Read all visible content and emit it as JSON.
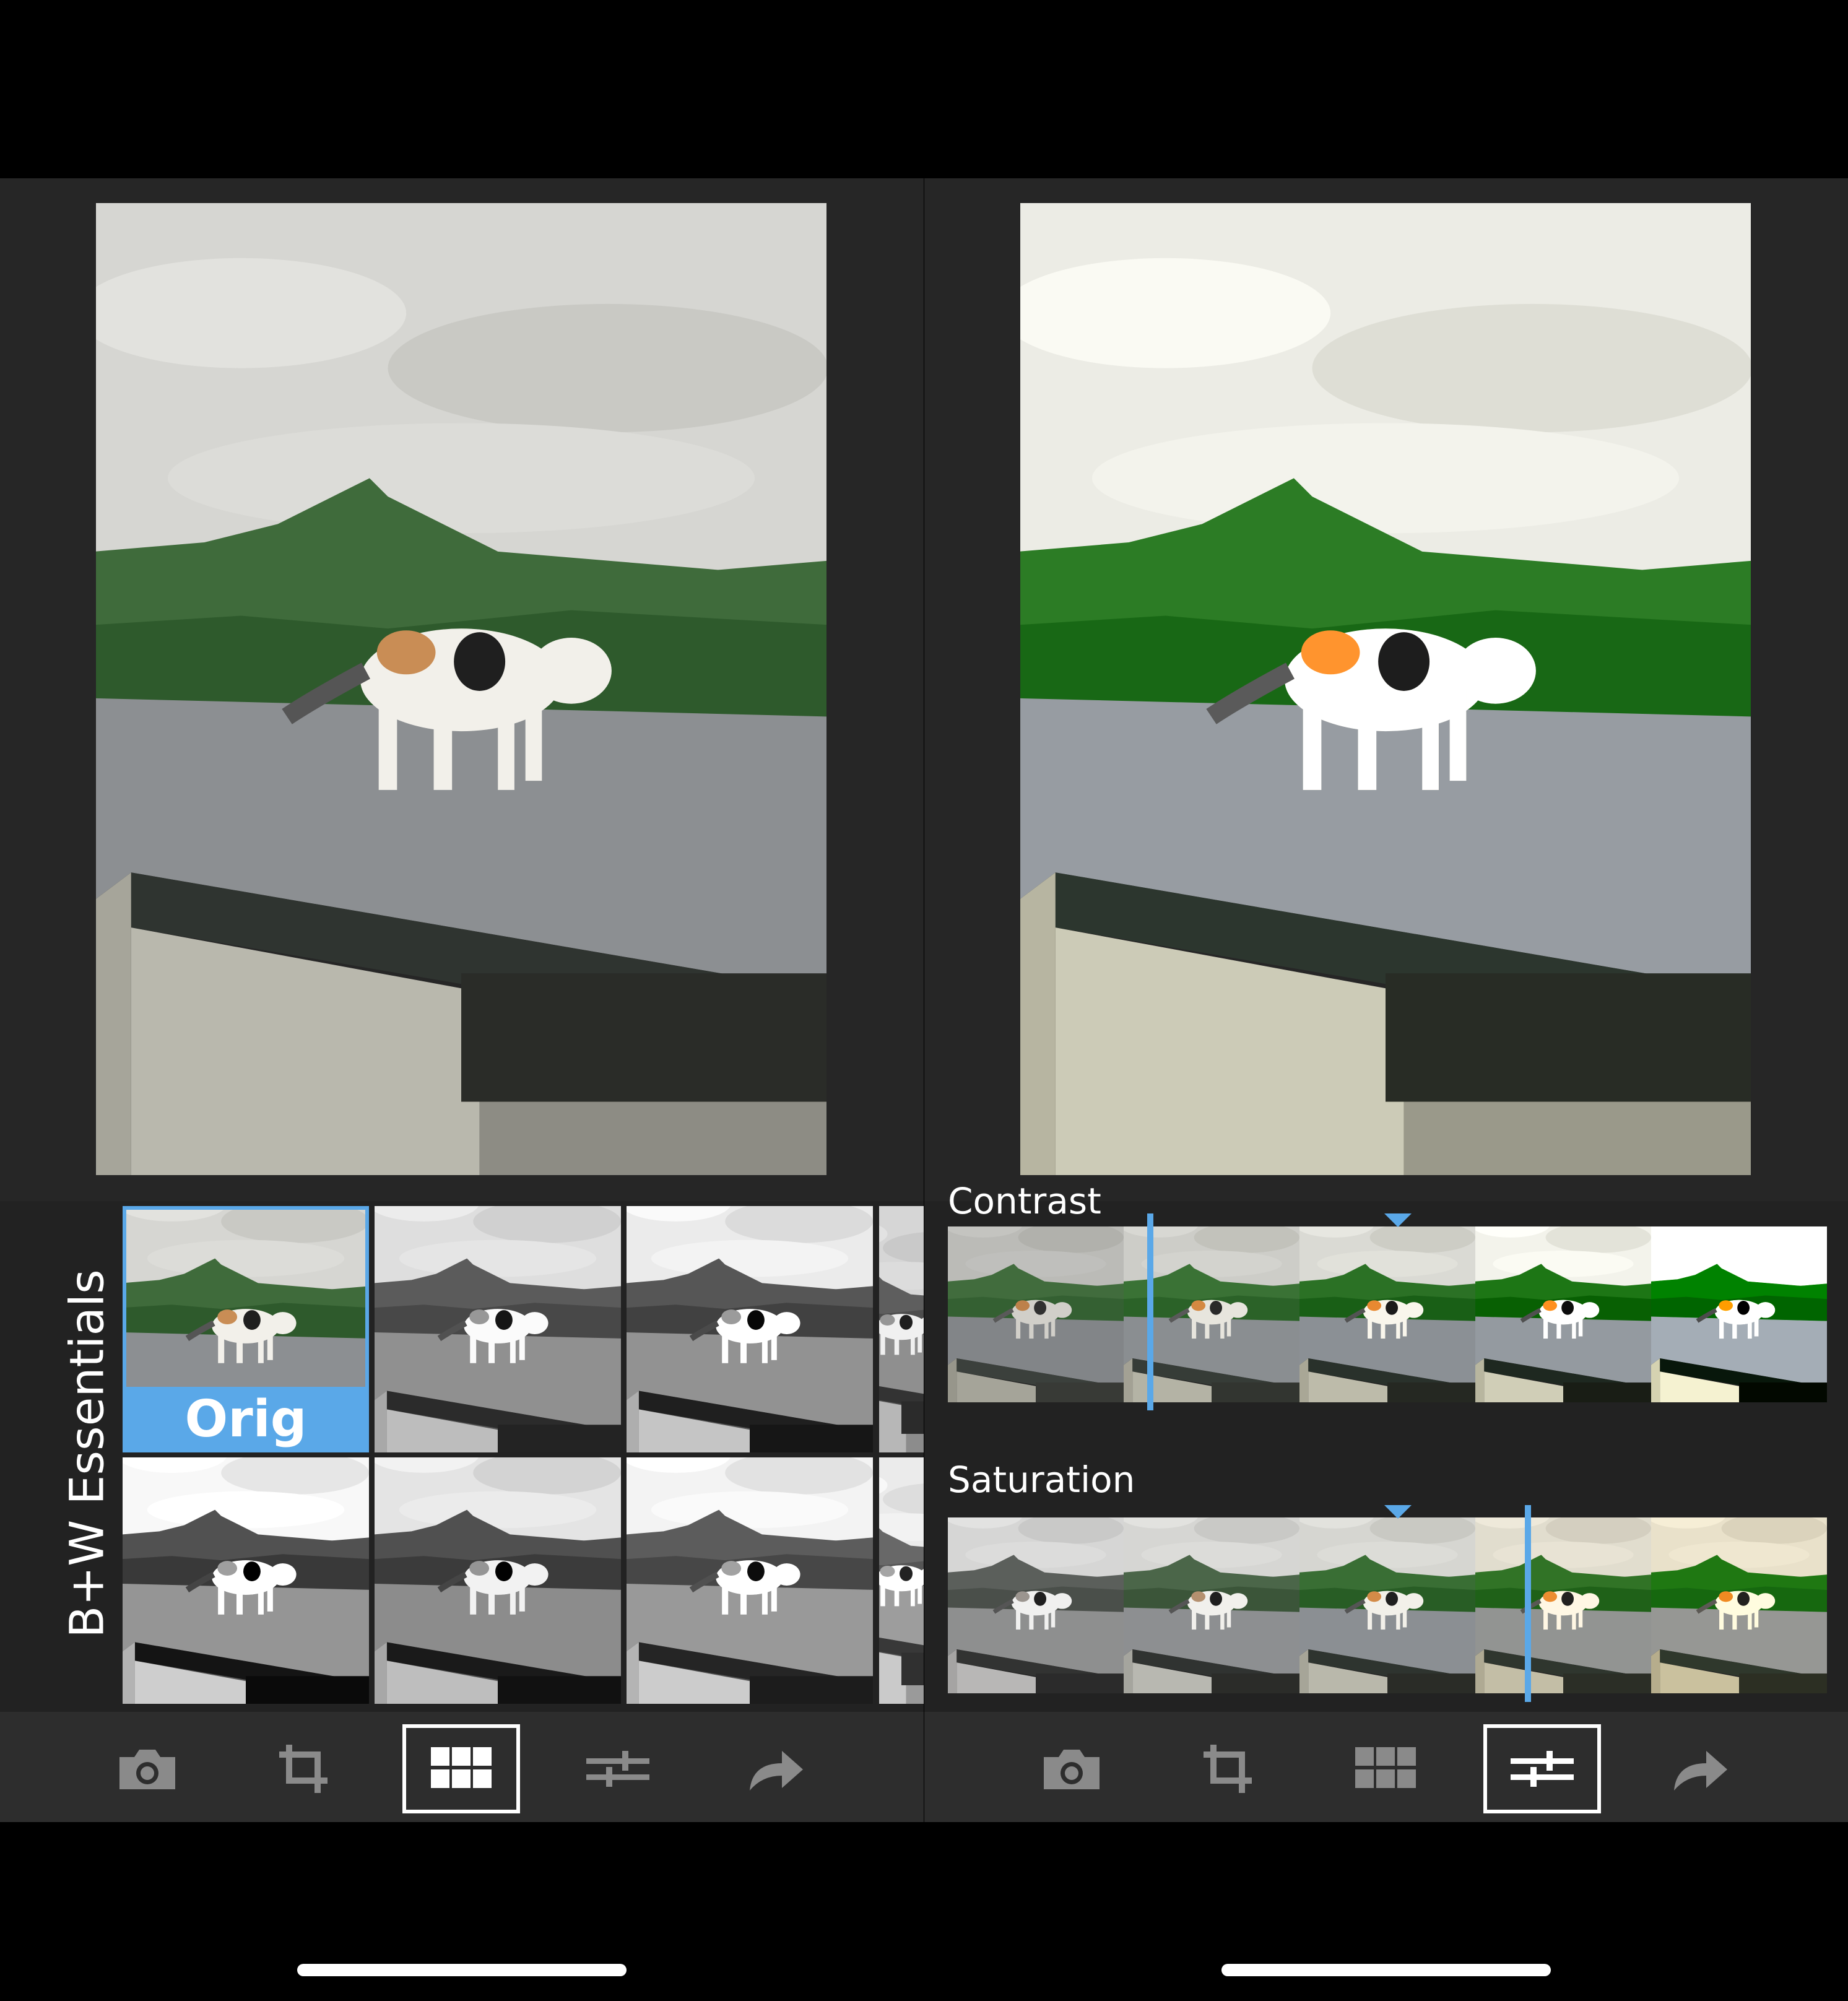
{
  "left_panel": {
    "section_title": "B+W Essentials",
    "selected_label": "Orig",
    "thumbnails": [
      {
        "filter": "orig",
        "selected": true,
        "label": "Orig"
      },
      {
        "filter": "bw"
      },
      {
        "filter": "bw"
      },
      {
        "filter": "bw"
      },
      {
        "filter": "bw"
      },
      {
        "filter": "bw"
      }
    ],
    "toolbar": [
      {
        "icon": "camera-icon",
        "active": false
      },
      {
        "icon": "crop-icon",
        "active": false
      },
      {
        "icon": "grid-filters-icon",
        "active": true
      },
      {
        "icon": "sliders-icon",
        "active": false
      },
      {
        "icon": "share-arrow-icon",
        "active": false
      }
    ]
  },
  "right_panel": {
    "contrast_label": "Contrast",
    "saturation_label": "Saturation",
    "contrast_level": 0.23,
    "saturation_level": 0.66,
    "toolbar": [
      {
        "icon": "camera-icon",
        "active": false
      },
      {
        "icon": "crop-icon",
        "active": false
      },
      {
        "icon": "grid-filters-icon",
        "active": false
      },
      {
        "icon": "sliders-icon",
        "active": true
      },
      {
        "icon": "share-arrow-icon",
        "active": false
      }
    ]
  },
  "colors": {
    "accent": "#5aa8e8",
    "panel_bg": "#262626",
    "toolbar_bg": "#2d2d2d",
    "icon_inactive": "#8a8a8a"
  }
}
